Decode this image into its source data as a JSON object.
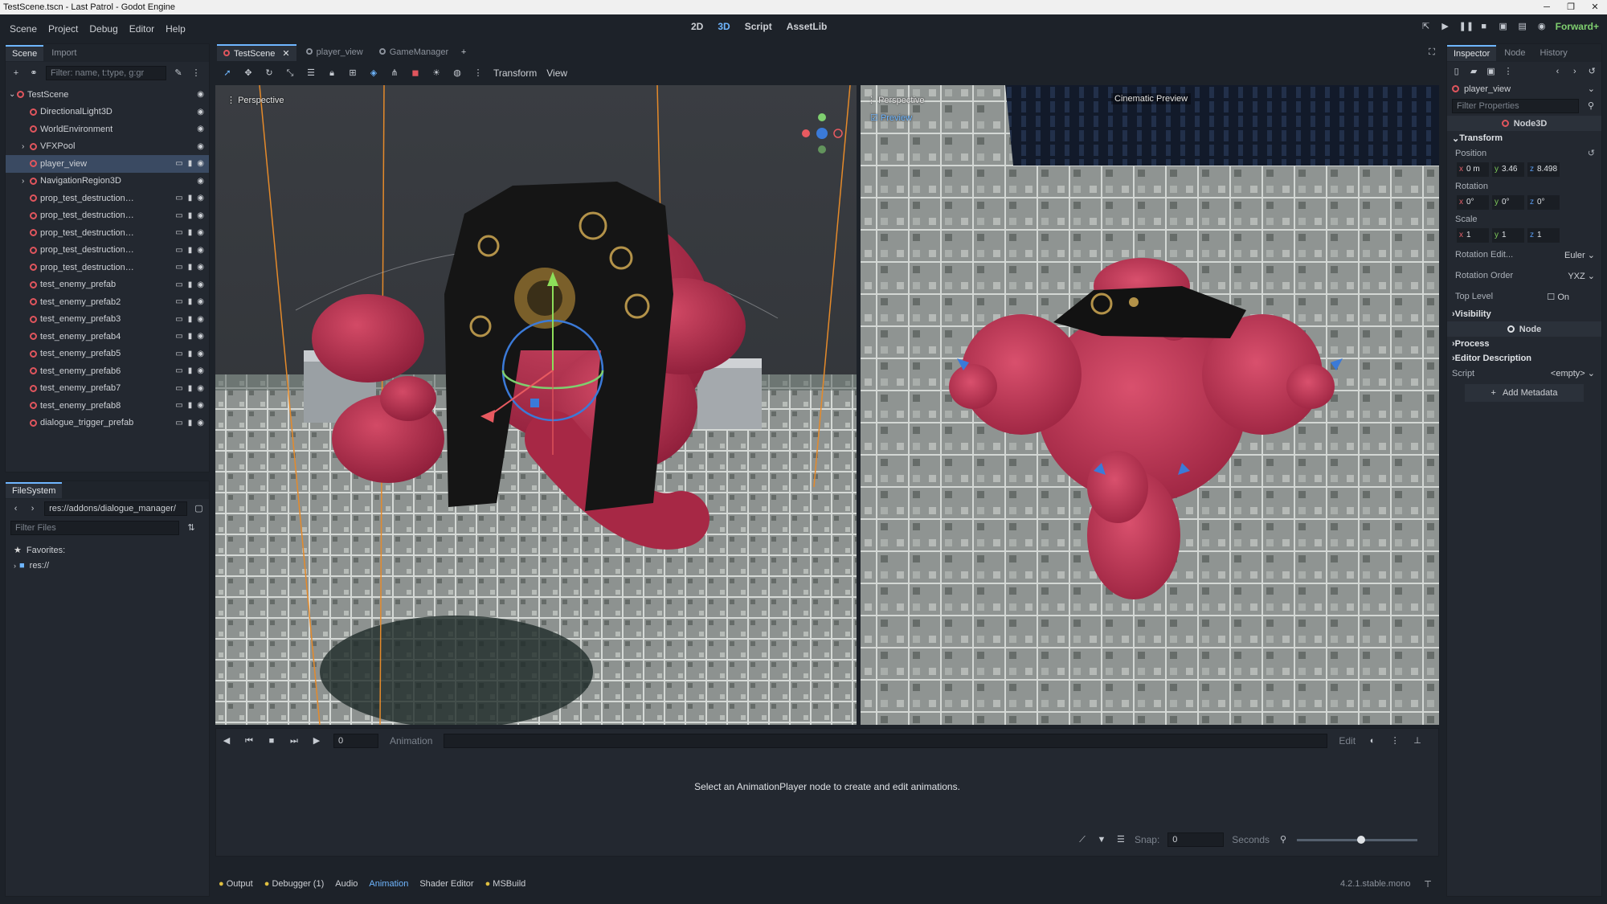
{
  "window": {
    "title": "TestScene.tscn - Last Patrol - Godot Engine"
  },
  "menu": [
    "Scene",
    "Project",
    "Debug",
    "Editor",
    "Help"
  ],
  "workspaces": [
    {
      "label": "2D",
      "active": false
    },
    {
      "label": "3D",
      "active": true
    },
    {
      "label": "Script",
      "active": false
    },
    {
      "label": "AssetLib",
      "active": false
    }
  ],
  "renderer": "Forward+",
  "scene_dock": {
    "tabs": [
      "Scene",
      "Import"
    ],
    "filter_placeholder": "Filter: name, t:type, g:gr",
    "nodes": [
      {
        "name": "TestScene",
        "depth": 0,
        "color": "#e0555d",
        "expand": "⌄",
        "selected": false,
        "extra": false
      },
      {
        "name": "DirectionalLight3D",
        "depth": 1,
        "color": "#e0555d",
        "expand": "",
        "selected": false,
        "extra": false
      },
      {
        "name": "WorldEnvironment",
        "depth": 1,
        "color": "#e0555d",
        "expand": "",
        "selected": false,
        "extra": false
      },
      {
        "name": "VFXPool",
        "depth": 1,
        "color": "#e0555d",
        "expand": "›",
        "selected": false,
        "extra": false
      },
      {
        "name": "player_view",
        "depth": 1,
        "color": "#e0555d",
        "expand": "",
        "selected": true,
        "extra": true
      },
      {
        "name": "NavigationRegion3D",
        "depth": 1,
        "color": "#e0555d",
        "expand": "›",
        "selected": false,
        "extra": false
      },
      {
        "name": "prop_test_destruction_pre...",
        "depth": 1,
        "color": "#e0555d",
        "expand": "",
        "selected": false,
        "extra": true
      },
      {
        "name": "prop_test_destruction_pre...",
        "depth": 1,
        "color": "#e0555d",
        "expand": "",
        "selected": false,
        "extra": true
      },
      {
        "name": "prop_test_destruction_pre...",
        "depth": 1,
        "color": "#e0555d",
        "expand": "",
        "selected": false,
        "extra": true
      },
      {
        "name": "prop_test_destruction_pre...",
        "depth": 1,
        "color": "#e0555d",
        "expand": "",
        "selected": false,
        "extra": true
      },
      {
        "name": "prop_test_destruction_pre...",
        "depth": 1,
        "color": "#e0555d",
        "expand": "",
        "selected": false,
        "extra": true
      },
      {
        "name": "test_enemy_prefab",
        "depth": 1,
        "color": "#e0555d",
        "expand": "",
        "selected": false,
        "extra": true
      },
      {
        "name": "test_enemy_prefab2",
        "depth": 1,
        "color": "#e0555d",
        "expand": "",
        "selected": false,
        "extra": true
      },
      {
        "name": "test_enemy_prefab3",
        "depth": 1,
        "color": "#e0555d",
        "expand": "",
        "selected": false,
        "extra": true
      },
      {
        "name": "test_enemy_prefab4",
        "depth": 1,
        "color": "#e0555d",
        "expand": "",
        "selected": false,
        "extra": true
      },
      {
        "name": "test_enemy_prefab5",
        "depth": 1,
        "color": "#e0555d",
        "expand": "",
        "selected": false,
        "extra": true
      },
      {
        "name": "test_enemy_prefab6",
        "depth": 1,
        "color": "#e0555d",
        "expand": "",
        "selected": false,
        "extra": true
      },
      {
        "name": "test_enemy_prefab7",
        "depth": 1,
        "color": "#e0555d",
        "expand": "",
        "selected": false,
        "extra": true
      },
      {
        "name": "test_enemy_prefab8",
        "depth": 1,
        "color": "#e0555d",
        "expand": "",
        "selected": false,
        "extra": true
      },
      {
        "name": "dialogue_trigger_prefab",
        "depth": 1,
        "color": "#e0555d",
        "expand": "",
        "selected": false,
        "extra": true
      }
    ]
  },
  "filesystem": {
    "tab": "FileSystem",
    "path": "res://addons/dialogue_manager/",
    "filter_placeholder": "Filter Files",
    "items": [
      "Favorites:",
      "res://"
    ]
  },
  "editor_tabs": [
    {
      "label": "TestScene",
      "active": true
    },
    {
      "label": "player_view",
      "active": false
    },
    {
      "label": "GameManager",
      "active": false
    }
  ],
  "viewport_menu": {
    "transform": "Transform",
    "view": "View"
  },
  "viewport": {
    "left_label": "Perspective",
    "right_label": "Perspective",
    "preview_label": "Preview",
    "cinematic": "Cinematic Preview"
  },
  "animation": {
    "frame": "0",
    "label": "Animation",
    "edit": "Edit",
    "message": "Select an AnimationPlayer node to create and edit animations.",
    "snap_label": "Snap:",
    "snap_value": "0",
    "unit": "Seconds"
  },
  "bottom_tabs": [
    {
      "label": "Output",
      "dot": true,
      "active": false
    },
    {
      "label": "Debugger (1)",
      "dot": true,
      "active": false
    },
    {
      "label": "Audio",
      "dot": false,
      "active": false
    },
    {
      "label": "Animation",
      "dot": false,
      "active": true
    },
    {
      "label": "Shader Editor",
      "dot": false,
      "active": false
    },
    {
      "label": "MSBuild",
      "dot": true,
      "active": false
    }
  ],
  "version": "4.2.1.stable.mono",
  "inspector": {
    "tabs": [
      "Inspector",
      "Node",
      "History"
    ],
    "object": "player_view",
    "filter_placeholder": "Filter Properties",
    "class_name": "Node3D",
    "transform": "Transform",
    "position_label": "Position",
    "position": {
      "x": "0 m",
      "y": "3.46",
      "z": "8.498"
    },
    "rotation_label": "Rotation",
    "rotation": {
      "x": "0°",
      "y": "0°",
      "z": "0°"
    },
    "scale_label": "Scale",
    "scale": {
      "x": "1",
      "y": "1",
      "z": "1"
    },
    "rotation_edit_label": "Rotation Edit...",
    "rotation_edit": "Euler",
    "rotation_order_label": "Rotation Order",
    "rotation_order": "YXZ",
    "top_level_label": "Top Level",
    "top_level": "On",
    "visibility": "Visibility",
    "node_section": "Node",
    "process": "Process",
    "editor_description": "Editor Description",
    "script_label": "Script",
    "script_value": "<empty>",
    "add_metadata": "Add Metadata"
  }
}
